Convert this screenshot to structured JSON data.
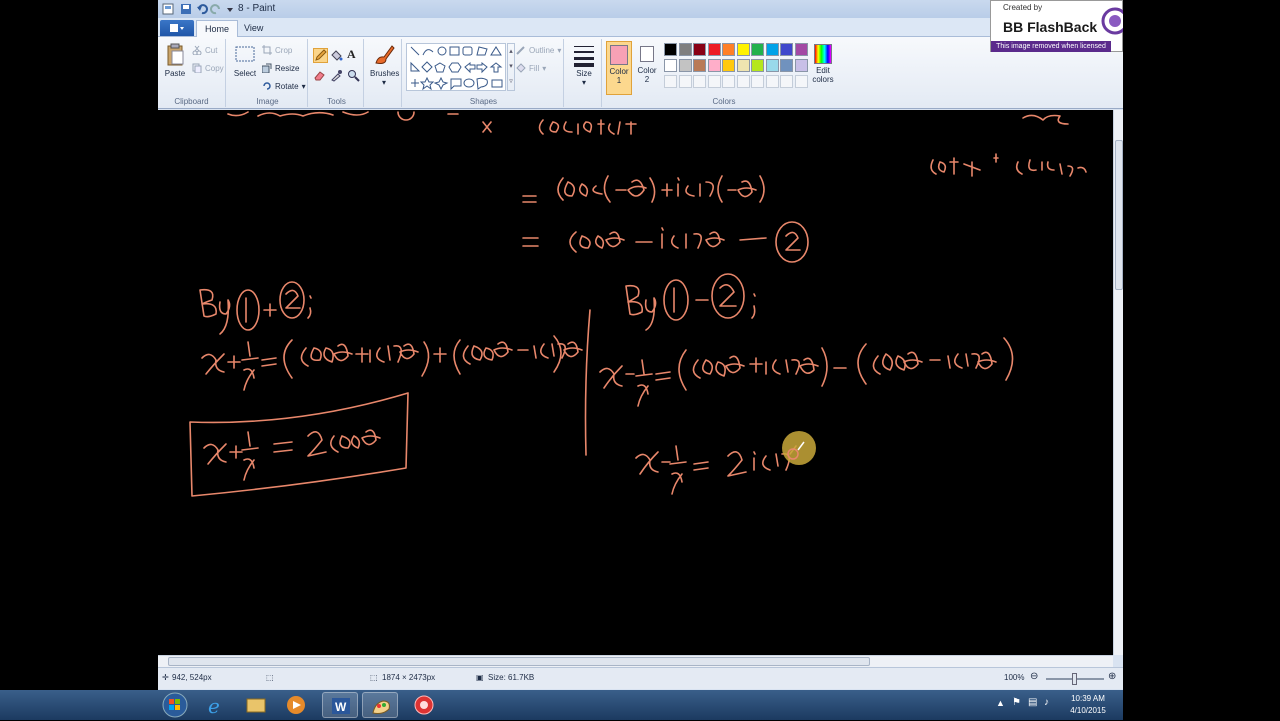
{
  "window": {
    "title": "8 - Paint"
  },
  "tabs": {
    "file": "",
    "home": "Home",
    "view": "View"
  },
  "ribbon": {
    "clipboard": {
      "label": "Clipboard",
      "paste": "Paste",
      "cut": "Cut",
      "copy": "Copy"
    },
    "image": {
      "label": "Image",
      "select": "Select",
      "crop": "Crop",
      "resize": "Resize",
      "rotate": "Rotate"
    },
    "tools": {
      "label": "Tools",
      "text_tool": "A"
    },
    "brushes": {
      "label": "Brushes"
    },
    "shapes": {
      "label": "Shapes",
      "outline": "Outline",
      "fill": "Fill"
    },
    "size": {
      "label": "Size"
    },
    "colors": {
      "label": "Colors",
      "color1_label": "Color",
      "color1_num": "1",
      "color2_label": "Color",
      "color2_num": "2",
      "edit_label": "Edit",
      "edit_label2": "colors",
      "color1_value": "#f7a1b5",
      "color2_value": "#ffffff",
      "palette_row1": [
        "#000000",
        "#7f7f7f",
        "#880015",
        "#ed1c24",
        "#ff7f27",
        "#fff200",
        "#22b14c",
        "#00a2e8",
        "#3f48cc",
        "#a349a4"
      ],
      "palette_row2": [
        "#ffffff",
        "#c3c3c3",
        "#b97a57",
        "#ffaec9",
        "#ffc90e",
        "#efe4b0",
        "#b5e61d",
        "#99d9ea",
        "#7092be",
        "#c8bfe7"
      ]
    }
  },
  "status": {
    "cursor_pos": "942, 524px",
    "dimensions": "1874 × 2473px",
    "size": "Size: 61.7KB",
    "zoom": "100%"
  },
  "taskbar": {
    "time": "10:39 AM",
    "date": "4/10/2015"
  },
  "watermark": {
    "created_by": "Created by",
    "brand": "BB FlashBack",
    "note": "This image removed when licensed"
  }
}
